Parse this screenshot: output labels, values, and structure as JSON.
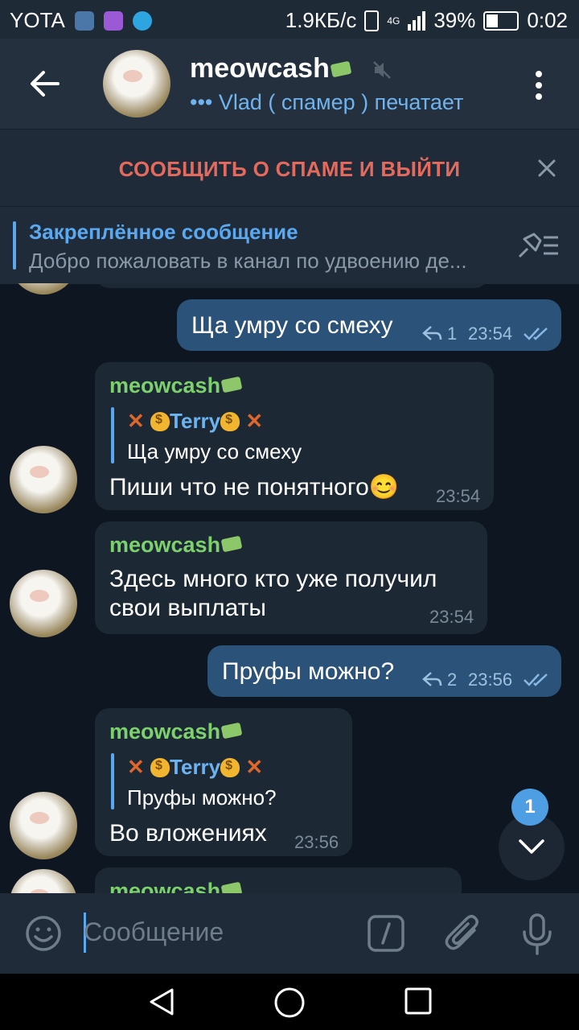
{
  "status_bar": {
    "carrier": "YOTA",
    "speed": "1.9КБ/с",
    "network": "4G",
    "battery": "39%",
    "time": "0:02"
  },
  "header": {
    "title": "meowcash",
    "subtitle": "••• Vlad ( спамер ) печатает"
  },
  "spam_bar": {
    "label": "СООБЩИТЬ О СПАМЕ И ВЫЙТИ"
  },
  "pinned": {
    "title": "Закреплённое сообщение",
    "text": "Добро пожаловать в канал по удвоению де..."
  },
  "messages": [
    {
      "dir": "out",
      "text": "Ща умру со смеху",
      "replies": "1",
      "time": "23:54"
    },
    {
      "dir": "in",
      "sender": "meowcash",
      "quote_name": "Terry",
      "quote_text": "Ща умру со смеху",
      "text": "Пиши что не понятного😊",
      "time": "23:54"
    },
    {
      "dir": "in",
      "sender": "meowcash",
      "text_line1": "Здесь много кто уже получил",
      "text_line2": "свои выплаты",
      "time": "23:54"
    },
    {
      "dir": "out",
      "text": "Пруфы можно?",
      "replies": "2",
      "time": "23:56"
    },
    {
      "dir": "in",
      "sender": "meowcash",
      "quote_name": "Terry",
      "quote_text": "Пруфы можно?",
      "text": "Во вложениях",
      "time": "23:56"
    },
    {
      "dir": "in",
      "sender": "meowcash"
    }
  ],
  "unread_badge": "1",
  "input": {
    "placeholder": "Сообщение"
  },
  "colors": {
    "background": "#0e1621",
    "incoming_bubble": "#1c2834",
    "outgoing_bubble": "#2b5278",
    "accent": "#5aa8f0",
    "sender": "#7dd16d",
    "spam": "#e56a5d"
  }
}
